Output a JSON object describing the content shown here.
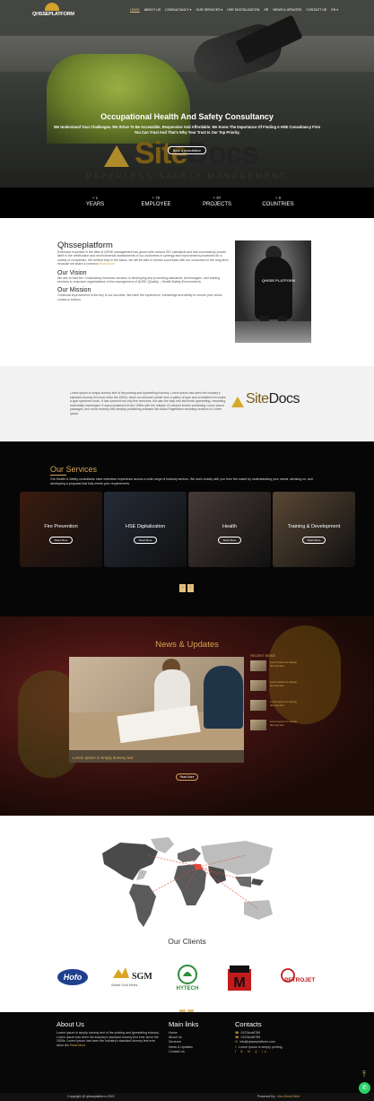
{
  "nav": {
    "brand": "QHSSEPLATFORM",
    "items": [
      {
        "label": "HOME",
        "active": true
      },
      {
        "label": "ABOUT US"
      },
      {
        "label": "CONSULTANCY ▾"
      },
      {
        "label": "OUR SERVICES ▾"
      },
      {
        "label": "HSE DIGITALIZATION"
      },
      {
        "label": "SR"
      },
      {
        "label": "NEWS & UPDATES"
      },
      {
        "label": "CONTACT US"
      },
      {
        "label": "EN ▾"
      }
    ]
  },
  "hero": {
    "title": "Occupational Health And Safety Consultancy",
    "subtitle": "We Understand Your Challenges. We Strive To Be Accessible, Responsive And Affordable. We Know The Importance Of Finding A HSE Consultancy Firm You Can Trust And That's Why Your Trust Is Our Top Priority.",
    "button": "Book a consultation",
    "sitedocs_site": "Site",
    "sitedocs_docs": "Docs",
    "tagline": "PAPERLESS SAFETY MANAGEMENT"
  },
  "stats": [
    {
      "number": "+ 1",
      "label": "YEARS"
    },
    {
      "number": "+ 70",
      "label": "EMPLOYEE"
    },
    {
      "number": "+ 97",
      "label": "PROJECTS"
    },
    {
      "number": "+ 0",
      "label": "COUNTRIES"
    }
  ],
  "about": {
    "title": "Qhsseplatform",
    "text": "Extensive expertise in the field of QHSE management has grown with various ISO standards and has successfully proven itself in the certification and environmental assessments of our customers in synergy and improvement processes for a variety of companies. We believe that in the future, we will be able to remain successful with our customers in the long term because we share a common",
    "read_more": "Read More",
    "vision_title": "Our Vision",
    "vision_text": "We aim to lead the Consultancy business services in developing and promoting standards, technologies, and training services to empower organizations in the management of QHSE (Quality – Health-Safety-Environment).",
    "mission_title": "Our Mission",
    "mission_text": "Continual improvement is the key to our success. We have the experience, knowledge and ability to ensure your vision comes to fruition.",
    "photo_text": "QHSSE PLATFORM"
  },
  "sitedocs_band": {
    "text": "Lorem Ipsum is simply dummy text of the printing and typesetting industry. Lorem Ipsum has been the industry's standard dummy text ever since the 1500s, when an unknown printer took a galley of type and scrambled it to make a type specimen book. It has survived not only five centuries, but also the leap into electronic typesetting, remaining essentially unchanged. It was popularised in the 1960s with the release of Letraset sheets containing Lorem Ipsum passages, and more recently with desktop publishing software like Aldus PageMaker including versions of Lorem Ipsum.",
    "logo_site": "Site",
    "logo_docs": "Docs"
  },
  "services": {
    "title": "Our Services",
    "desc": "Our Health & Safety consultants have extensive experience across a wide range of industry sectors. We work closely with you from the outset by understanding your needs, advising on, and developing a proposal that fully meets your requirements.",
    "cards": [
      {
        "title": "Fire Prevention",
        "button": "Read More",
        "color": "#5a2a16"
      },
      {
        "title": "HSE Digitalization",
        "button": "Read More",
        "color": "#3a4456"
      },
      {
        "title": "Health",
        "button": "Read More",
        "color": "#6d5a55"
      },
      {
        "title": "Training & Development",
        "button": "Read More",
        "color": "#8a6e52"
      }
    ],
    "pager": [
      "‹",
      "›"
    ]
  },
  "news": {
    "title": "News & Updates",
    "featured_caption": "Lorem Ipsum is simply dummy text",
    "button": "Read More",
    "recent_title": "RECENT NEWS",
    "recent": [
      "Lorem Ipsum is simply dummy text",
      "Lorem Ipsum is simply dummy text",
      "Lorem Ipsum is simply dummy text",
      "Lorem Ipsum is simply dummy text"
    ]
  },
  "clients": {
    "title": "Our Clients",
    "logos": [
      {
        "name": "Hofo"
      },
      {
        "name": "SGM",
        "sub": "Sukari Gold Mines"
      },
      {
        "name": "HYTECH"
      },
      {
        "name": "M"
      },
      {
        "name": "PETROJET"
      }
    ],
    "pager": [
      "‹",
      "›"
    ]
  },
  "footer": {
    "about_title": "About Us",
    "about_text": "Lorem Ipsum is simply dummy text of the printing and typesetting industry. Lorem Ipsum has been the industry's standard dummy text ever since the 1500s. Lorem Ipsum has been the industry's standard dummy text ever since the",
    "about_more": "Read More",
    "links_title": "Main links",
    "links": [
      "Home",
      "About Us",
      "Services",
      "News & Updates",
      "Contact Us"
    ],
    "contacts_title": "Contacts",
    "phone1": "01234cd6789",
    "phone2": "01234cd6789",
    "email": "info@qhsseplatform.com",
    "address": "Lorem Ipsum is simply printing",
    "social": "f ✆ ✉ ◎ in",
    "copyright": "Copyright @ qhsseplatform 2022",
    "powered_label": "Powered By :",
    "powered_by": "Abu World Web"
  }
}
